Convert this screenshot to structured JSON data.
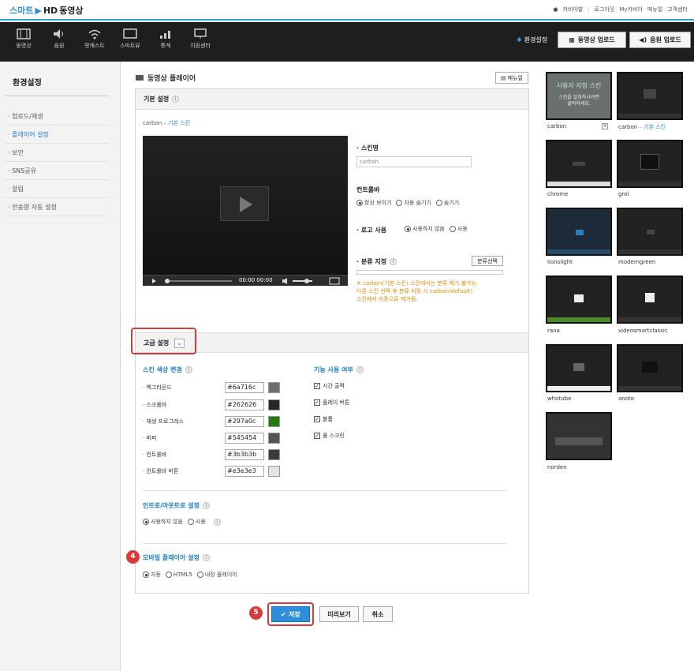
{
  "header": {
    "logo_smart": "스마트",
    "logo_hd": "HD",
    "logo_title": "동영상",
    "links": [
      "카비아발",
      "로그아웃",
      "My카비아",
      "매뉴얼",
      "고객센터"
    ]
  },
  "nav": {
    "items": [
      {
        "label": "동영상",
        "icon": "film-icon"
      },
      {
        "label": "음원",
        "icon": "speaker-icon"
      },
      {
        "label": "팟캐스트",
        "icon": "wifi-icon"
      },
      {
        "label": "스마트뷰",
        "icon": "monitor-icon"
      },
      {
        "label": "통계",
        "icon": "bar-chart-icon"
      },
      {
        "label": "지원센터",
        "icon": "support-monitor-icon"
      }
    ],
    "env_settings": "환경설정",
    "video_upload": "동영상 업로드",
    "audio_upload": "음원 업로드"
  },
  "sidebar": {
    "title": "환경설정",
    "items": [
      {
        "label": "업로드/재생",
        "active": false
      },
      {
        "label": "플레이어 설정",
        "active": true
      },
      {
        "label": "보안",
        "active": false
      },
      {
        "label": "SNS공유",
        "active": false
      },
      {
        "label": "알림",
        "active": false
      },
      {
        "label": "전송량 자동 설정",
        "active": false
      }
    ]
  },
  "main": {
    "title": "동영상 플레이어",
    "manual_button": "매뉴얼",
    "basic_section": "기본 설정",
    "skin_current": "carbon",
    "skin_current_link": "– 기본 스킨",
    "player_time": "00:00 00:00",
    "skin_name_label": "스킨명",
    "skin_name_value": "carbon",
    "controlbar_label": "컨트롤바",
    "controlbar_options": [
      "항상 보이기",
      "자동 숨기기",
      "숨기기"
    ],
    "logo_label": "로고 사용",
    "logo_options": [
      "사용하지 않음",
      "사용"
    ],
    "watermark_label": "분류 지정",
    "watermark_button": "분류선택",
    "warning_lines": [
      "※ carbon(기본 스킨) 스킨에서는 분류 제거 불가능.",
      "다른 스킨 선택 후 분류 지정 시 carbon(default)",
      "스킨에서 자동으로 제거됨."
    ],
    "advanced_section": "고급 설정",
    "skin_color_title": "스킨 색상 변경",
    "colors": [
      {
        "name": "백그라운드",
        "hex": "#6a716c"
      },
      {
        "name": "스크롤바",
        "hex": "#262626"
      },
      {
        "name": "재생 프로그레스",
        "hex": "#297a0c"
      },
      {
        "name": "버퍼",
        "hex": "#545454"
      },
      {
        "name": "컨트롤바",
        "hex": "#3b3b3b"
      },
      {
        "name": "컨트롤바 버튼",
        "hex": "#e3e3e3"
      }
    ],
    "feature_title": "기능 사용 여부",
    "features": [
      "시간 출력",
      "플레이 버튼",
      "볼륨",
      "풀 스크린"
    ],
    "intro_title": "인트로/아웃트로 설정",
    "intro_options": [
      "사용하지 않음",
      "사용"
    ],
    "mobile_title": "모바일 플레이어 설정",
    "mobile_options": [
      "자동",
      "HTML5",
      "내장 플레이어"
    ],
    "save_button": "저장",
    "preview_button": "미리보기",
    "cancel_button": "취소",
    "step4": "4",
    "step5": "5"
  },
  "thumbs": [
    {
      "label": "carbon",
      "link": ""
    },
    {
      "label": "carbon",
      "link": " – 기본 스킨"
    },
    {
      "label": "chrome",
      "link": ""
    },
    {
      "label": "grol",
      "link": ""
    },
    {
      "label": "lionslight",
      "link": ""
    },
    {
      "label": "moderngreen",
      "link": ""
    },
    {
      "label": "rana",
      "link": ""
    },
    {
      "label": "videosmartclassic",
      "link": ""
    },
    {
      "label": "whotube",
      "link": ""
    },
    {
      "label": "anoto",
      "link": ""
    },
    {
      "label": "norden",
      "link": ""
    }
  ],
  "thumb_preview": {
    "title": "사용자 지정 스킨",
    "line1": "스킨을 설정하시려면",
    "line2": "클릭하세요."
  }
}
